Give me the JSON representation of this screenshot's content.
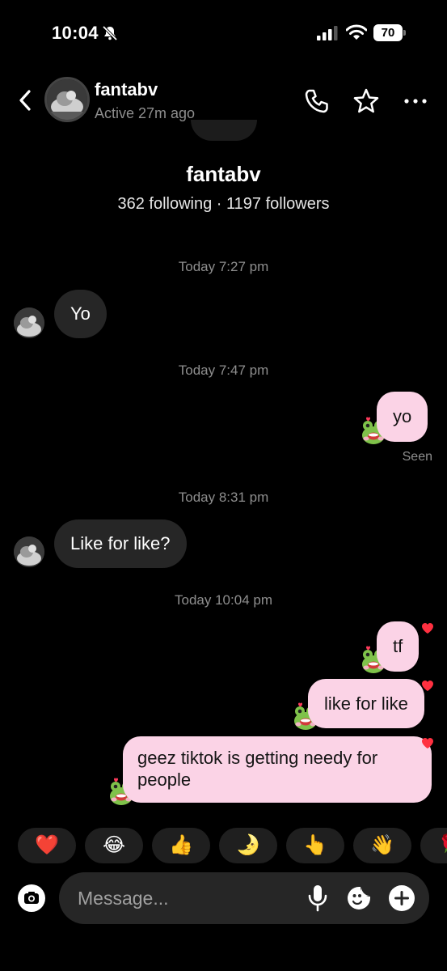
{
  "status_bar": {
    "time": "10:04",
    "battery": "70",
    "silent_icon": "bell-slash-icon",
    "signal_icon": "cellular-signal-icon",
    "wifi_icon": "wifi-icon"
  },
  "header": {
    "name": "fantabv",
    "active": "Active 27m ago",
    "icons": [
      "back-chevron-icon",
      "phone-icon",
      "star-icon",
      "more-icon"
    ]
  },
  "profile": {
    "name": "fantabv",
    "stats": "362 following · 1197 followers"
  },
  "conversation": [
    {
      "type": "timestamp",
      "text": "Today 7:27 pm"
    },
    {
      "type": "incoming",
      "text": "Yo"
    },
    {
      "type": "timestamp",
      "text": "Today 7:47 pm"
    },
    {
      "type": "outgoing",
      "text": "yo",
      "sticker": "frog-sticker"
    },
    {
      "type": "receipt",
      "text": "Seen"
    },
    {
      "type": "timestamp",
      "text": "Today 8:31 pm"
    },
    {
      "type": "incoming",
      "text": "Like for like?"
    },
    {
      "type": "timestamp",
      "text": "Today 10:04 pm"
    },
    {
      "type": "outgoing",
      "text": "tf",
      "liked": true,
      "sticker": "frog-sticker"
    },
    {
      "type": "outgoing",
      "text": "like for like",
      "liked": true,
      "sticker": "frog-sticker"
    },
    {
      "type": "outgoing",
      "lines": [
        "geez tiktok is getting needy for",
        "people"
      ],
      "liked": true,
      "sticker": "frog-sticker"
    }
  ],
  "quick_reactions": [
    "❤️",
    "😂",
    "👍",
    "🌛",
    "👆",
    "👋",
    "🌹"
  ],
  "composer": {
    "placeholder": "Message...",
    "icons": [
      "camera-icon",
      "microphone-icon",
      "sticker-icon",
      "plus-icon"
    ]
  },
  "colors": {
    "background": "#000000",
    "incoming_bubble": "#262626",
    "outgoing_bubble": "#fbd3e6",
    "secondary_text": "#8e8e8e",
    "heart": "#ff3040"
  }
}
